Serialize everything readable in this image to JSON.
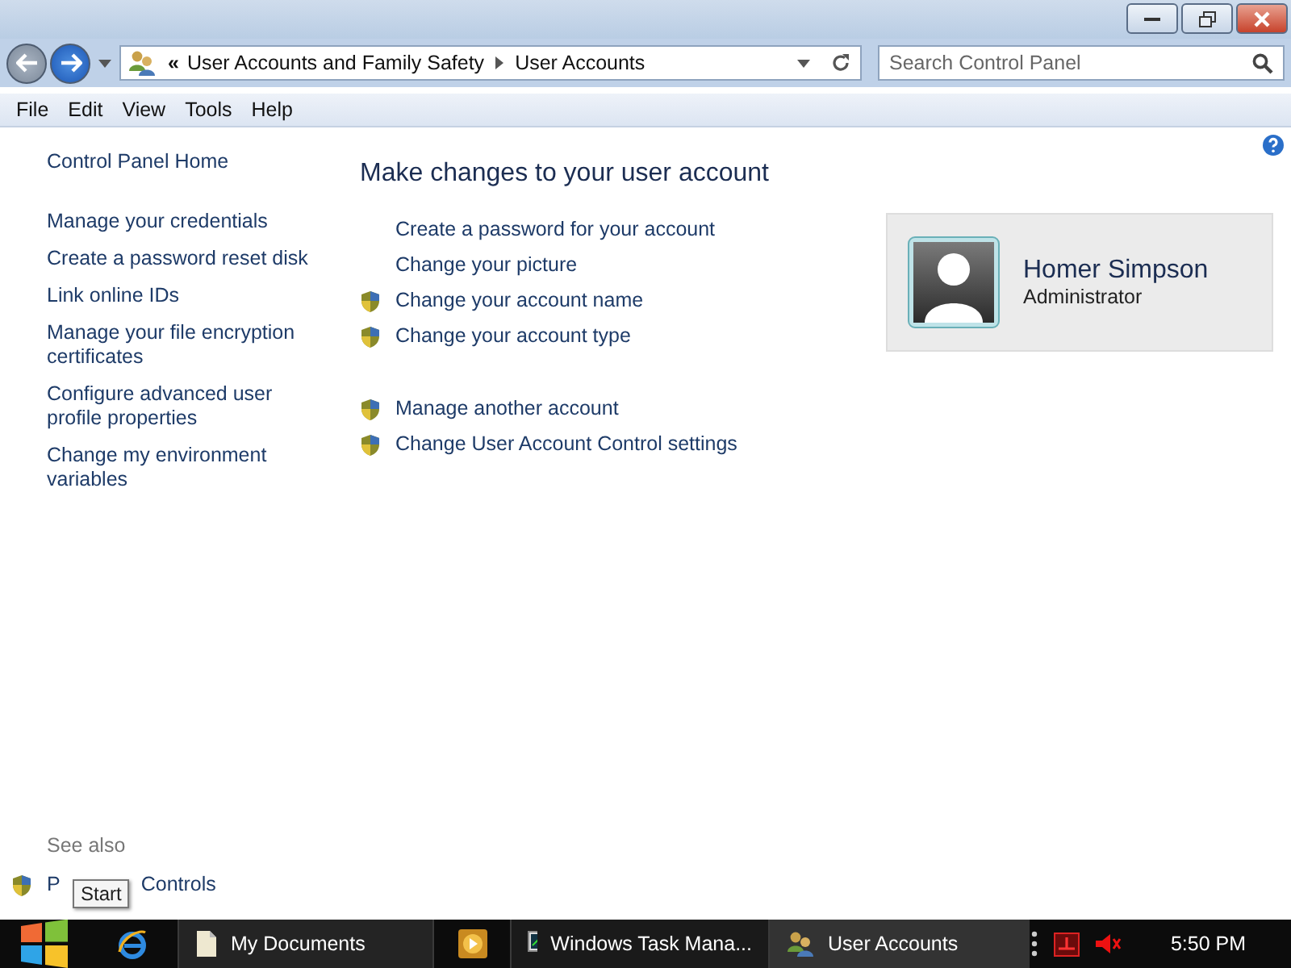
{
  "address_bar": {
    "breadcrumbs": [
      "«",
      "User Accounts and Family Safety",
      "User Accounts"
    ]
  },
  "search": {
    "placeholder": "Search Control Panel"
  },
  "menu_bar": [
    "File",
    "Edit",
    "View",
    "Tools",
    "Help"
  ],
  "sidebar": {
    "items": [
      {
        "label": "Control Panel Home"
      },
      {
        "label": "Manage your credentials"
      },
      {
        "label": "Create a password reset disk"
      },
      {
        "label": "Link online IDs"
      },
      {
        "label": "Manage your file encryption certificates"
      },
      {
        "label": "Configure advanced user profile properties"
      },
      {
        "label": "Change my environment variables"
      }
    ],
    "see_also": {
      "heading": "See also",
      "link_visible_start": "P",
      "link_visible_end": "Controls"
    }
  },
  "main": {
    "heading": "Make changes to your user account",
    "task_groups": [
      [
        {
          "label": "Create a password for your account",
          "shield": false
        },
        {
          "label": "Change your picture",
          "shield": false
        },
        {
          "label": "Change your account name",
          "shield": true
        },
        {
          "label": "Change your account type",
          "shield": true
        }
      ],
      [
        {
          "label": "Manage another account",
          "shield": true
        },
        {
          "label": "Change User Account Control settings",
          "shield": true
        }
      ]
    ],
    "account": {
      "name": "Homer Simpson",
      "role": "Administrator"
    }
  },
  "tooltip": "Start",
  "taskbar": {
    "buttons": [
      {
        "label": "My Documents",
        "kind": "folder"
      },
      {
        "kind": "media"
      },
      {
        "label": "Windows Task Mana...",
        "kind": "taskmgr"
      },
      {
        "label": "User Accounts",
        "kind": "users"
      }
    ],
    "clock": "5:50 PM"
  }
}
